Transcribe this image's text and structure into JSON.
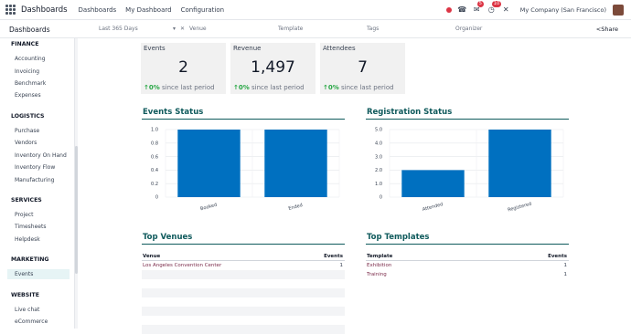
{
  "topbar": {
    "brand": "Dashboards",
    "nav": [
      "Dashboards",
      "My Dashboard",
      "Configuration"
    ],
    "badge_chat": "5",
    "badge_activity": "10",
    "company": "My Company (San Francisco)"
  },
  "subbar": {
    "title": "Dashboards",
    "date_filter": "Last 365 Days",
    "venue": "Venue",
    "template": "Template",
    "tags": "Tags",
    "organizer": "Organizer",
    "share": "Share"
  },
  "sidebar": {
    "sections": [
      {
        "title": "FINANCE",
        "items": [
          "Accounting",
          "Invoicing",
          "Benchmark",
          "Expenses"
        ]
      },
      {
        "title": "LOGISTICS",
        "items": [
          "Purchase",
          "Vendors",
          "Inventory On Hand",
          "Inventory Flow",
          "Manufacturing"
        ]
      },
      {
        "title": "SERVICES",
        "items": [
          "Project",
          "Timesheets",
          "Helpdesk"
        ]
      },
      {
        "title": "MARKETING",
        "items": [
          "Events"
        ]
      },
      {
        "title": "WEBSITE",
        "items": [
          "Live chat",
          "eCommerce"
        ]
      }
    ]
  },
  "kpis": [
    {
      "name": "Events",
      "value": "2",
      "trend": "0%",
      "suffix": "since last period"
    },
    {
      "name": "Revenue",
      "value": "1,497",
      "trend": "0%",
      "suffix": "since last period"
    },
    {
      "name": "Attendees",
      "value": "7",
      "trend": "0%",
      "suffix": "since last period"
    }
  ],
  "colors": {
    "accent": "#0f5a5c",
    "bar": "#0070c0",
    "positive": "#28a745",
    "link": "#7b2b4a"
  },
  "chart_data": [
    {
      "type": "bar",
      "title": "Events Status",
      "categories": [
        "Booked",
        "Ended"
      ],
      "values": [
        1,
        1
      ],
      "yticks": [
        "0",
        "0.2",
        "0.4",
        "0.6",
        "0.8",
        "1.0"
      ],
      "ylim": [
        0,
        1
      ]
    },
    {
      "type": "bar",
      "title": "Registration Status",
      "categories": [
        "Attended",
        "Registered"
      ],
      "values": [
        2,
        5
      ],
      "yticks": [
        "0",
        "1.0",
        "2.0",
        "3.0",
        "4.0",
        "5.0"
      ],
      "ylim": [
        0,
        5
      ]
    }
  ],
  "top_venues": {
    "title": "Top Venues",
    "headers": [
      "Venue",
      "Events"
    ],
    "rows": [
      [
        "Los Angeles Convention Center",
        "1"
      ]
    ]
  },
  "top_templates": {
    "title": "Top Templates",
    "headers": [
      "Template",
      "Events"
    ],
    "rows": [
      [
        "Exhibition",
        "1"
      ],
      [
        "Training",
        "1"
      ]
    ]
  }
}
